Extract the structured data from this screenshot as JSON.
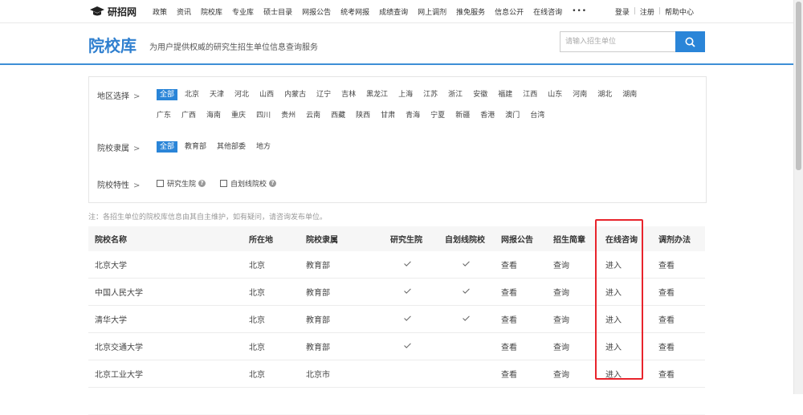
{
  "site": {
    "logo_text": "研招网",
    "logo_icon": "graduation-cap-icon"
  },
  "nav": [
    "政策",
    "资讯",
    "院校库",
    "专业库",
    "硕士目录",
    "网报公告",
    "统考网报",
    "成绩查询",
    "网上调剂",
    "推免服务",
    "信息公开",
    "在线咨询",
    "•••"
  ],
  "top_links": {
    "login": "登录",
    "register": "注册",
    "help": "帮助中心"
  },
  "header": {
    "title": "院校库",
    "subtitle": "为用户提供权威的研究生招生单位信息查询服务",
    "search_placeholder": "请输入招生单位",
    "search_icon": "search-icon"
  },
  "filters": {
    "region": {
      "label": "地区选择",
      "options": [
        "全部",
        "北京",
        "天津",
        "河北",
        "山西",
        "内蒙古",
        "辽宁",
        "吉林",
        "黑龙江",
        "上海",
        "江苏",
        "浙江",
        "安徽",
        "福建",
        "江西",
        "山东",
        "河南",
        "湖北",
        "湖南",
        "广东",
        "广西",
        "海南",
        "重庆",
        "四川",
        "贵州",
        "云南",
        "西藏",
        "陕西",
        "甘肃",
        "青海",
        "宁夏",
        "新疆",
        "香港",
        "澳门",
        "台湾"
      ]
    },
    "affiliation": {
      "label": "院校隶属",
      "options": [
        "全部",
        "教育部",
        "其他部委",
        "地方"
      ]
    },
    "features": {
      "label": "院校特性",
      "options": [
        "研究生院",
        "自划线院校"
      ]
    }
  },
  "note": "注：各招生单位的院校库信息由其自主维护，如有疑问，请咨询发布单位。",
  "table": {
    "headers": [
      "院校名称",
      "所在地",
      "院校隶属",
      "研究生院",
      "自划线院校",
      "网报公告",
      "招生简章",
      "在线咨询",
      "调剂办法"
    ],
    "rows": [
      {
        "name": "北京大学",
        "location": "北京",
        "affiliation": "教育部",
        "grad_school": true,
        "self_line": true,
        "notice": "查看",
        "brochure": "查询",
        "consult": "进入",
        "adjust": "查看"
      },
      {
        "name": "中国人民大学",
        "location": "北京",
        "affiliation": "教育部",
        "grad_school": true,
        "self_line": true,
        "notice": "查看",
        "brochure": "查询",
        "consult": "进入",
        "adjust": "查看"
      },
      {
        "name": "清华大学",
        "location": "北京",
        "affiliation": "教育部",
        "grad_school": true,
        "self_line": true,
        "notice": "查看",
        "brochure": "查询",
        "consult": "进入",
        "adjust": "查看"
      },
      {
        "name": "北京交通大学",
        "location": "北京",
        "affiliation": "教育部",
        "grad_school": true,
        "self_line": false,
        "notice": "查看",
        "brochure": "查询",
        "consult": "进入",
        "adjust": "查看"
      },
      {
        "name": "北京工业大学",
        "location": "北京",
        "affiliation": "北京市",
        "grad_school": false,
        "self_line": false,
        "notice": "查看",
        "brochure": "查询",
        "consult": "进入",
        "adjust": "查看"
      }
    ]
  },
  "colors": {
    "accent": "#2a85d8",
    "title": "#2f7fcf",
    "highlight_box": "#e8242c"
  }
}
